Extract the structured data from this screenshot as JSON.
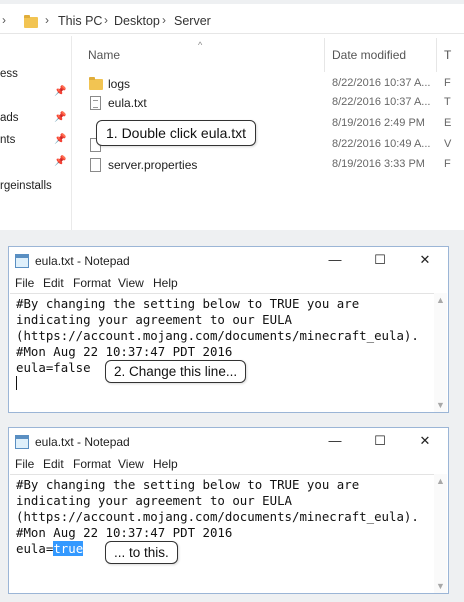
{
  "explorer": {
    "breadcrumb": [
      "This PC",
      "Desktop",
      "Server"
    ],
    "columns": {
      "name": "Name",
      "date": "Date modified",
      "type": "T"
    },
    "nav_items": [
      "ess",
      "ads",
      "nts",
      "rgeinstalls"
    ],
    "files": [
      {
        "name": "logs",
        "date": "8/22/2016 10:37 A...",
        "type": "F",
        "icon": "folder-icon"
      },
      {
        "name": "eula.txt",
        "date": "8/22/2016 10:37 A...",
        "type": "T",
        "icon": "text-file-icon"
      },
      {
        "name": "",
        "date": "8/19/2016 2:49 PM",
        "type": "E",
        "icon": "file-icon"
      },
      {
        "name": "",
        "date": "8/22/2016 10:49 A...",
        "type": "V",
        "icon": "file-icon"
      },
      {
        "name": "server.properties",
        "date": "8/19/2016 3:33 PM",
        "type": "F",
        "icon": "file-icon"
      }
    ],
    "callout": "1. Double click eula.txt"
  },
  "notepad1": {
    "title": "eula.txt - Notepad",
    "menu": [
      "File",
      "Edit",
      "Format",
      "View",
      "Help"
    ],
    "lines": [
      "#By changing the setting below to TRUE you are",
      "indicating your agreement to our EULA",
      "(https://account.mojang.com/documents/minecraft_eula).",
      "#Mon Aug 22 10:37:47 PDT 2016",
      "eula=false"
    ],
    "callout": "2. Change this line..."
  },
  "notepad2": {
    "title": "eula.txt - Notepad",
    "menu": [
      "File",
      "Edit",
      "Format",
      "View",
      "Help"
    ],
    "lines": [
      "#By changing the setting below to TRUE you are",
      "indicating your agreement to our EULA",
      "(https://account.mojang.com/documents/minecraft_eula).",
      "#Mon Aug 22 10:37:47 PDT 2016"
    ],
    "last_line_prefix": "eula=",
    "last_line_selected": "true",
    "callout": "... to this."
  },
  "window_controls": {
    "minimize": "—",
    "maximize": "☐",
    "close": "✕"
  },
  "colors": {
    "selection": "#3399ff",
    "folder": "#f2c452",
    "window_border": "#9bb5d6"
  }
}
